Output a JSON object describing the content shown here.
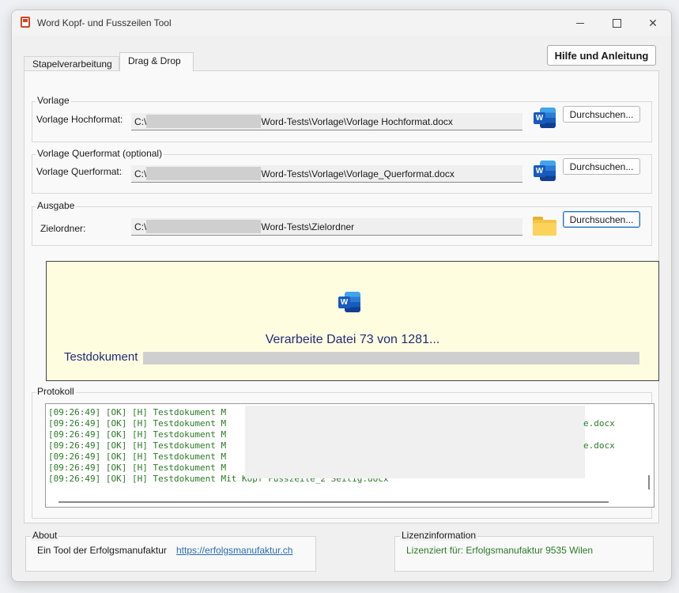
{
  "window": {
    "title": "Word Kopf- und Fusszeilen Tool"
  },
  "tabs": [
    {
      "label": "Stapelverarbeitung",
      "active": false
    },
    {
      "label": "Drag & Drop",
      "active": true
    }
  ],
  "help_button": {
    "label": "Hilfe und Anleitung"
  },
  "vorlage": {
    "group_label": "Vorlage",
    "field_label": "Vorlage Hochformat:",
    "path_prefix": "C:\\",
    "path_suffix": "Word-Tests\\Vorlage\\Vorlage Hochformat.docx",
    "browse_label": "Durchsuchen...",
    "icon": "word-icon"
  },
  "vorlage_quer": {
    "group_label": "Vorlage Querformat (optional)",
    "field_label": "Vorlage Querformat:",
    "path_prefix": "C:\\",
    "path_suffix": "Word-Tests\\Vorlage\\Vorlage_Querformat.docx",
    "browse_label": "Durchsuchen...",
    "icon": "word-icon"
  },
  "ausgabe": {
    "group_label": "Ausgabe",
    "field_label": "Zielordner:",
    "path_prefix": "C:\\",
    "path_suffix": "Word-Tests\\Zielordner",
    "browse_label": "Durchsuchen...",
    "icon": "folder-icon"
  },
  "dropzone": {
    "icon_letter": "W",
    "status": "Verarbeite Datei 73 von 1281...",
    "document_label": "Testdokument"
  },
  "protokoll": {
    "group_label": "Protokoll",
    "lines": [
      "[09:26:49] [OK] [H] Testdokument M",
      "[09:26:49] [OK] [H] Testdokument M",
      "[09:26:49] [OK] [H] Testdokument M",
      "[09:26:49] [OK] [H] Testdokument M",
      "[09:26:49] [OK] [H] Testdokument M",
      "[09:26:49] [OK] [H] Testdokument M",
      "[09:26:49] [OK] [H] Testdokument Mit  Kopf Fusszeile_2 Seitig.docx"
    ],
    "tails": [
      "e.docx",
      "e.docx"
    ]
  },
  "about": {
    "group_label": "About",
    "text": "Ein Tool der Erfolgsmanufaktur",
    "link": "https://erfolgsmanufaktur.ch"
  },
  "license": {
    "group_label": "Lizenzinformation",
    "text": "Lizenziert für: Erfolgsmanufaktur 9535 Wilen",
    "color": "#2a7a25"
  }
}
